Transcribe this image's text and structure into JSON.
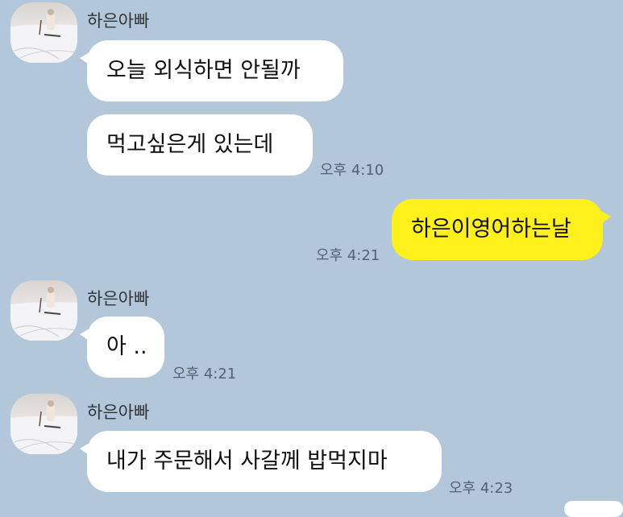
{
  "messages": [
    {
      "sender": "하은아빠",
      "text": "오늘 외식하면 안될까"
    },
    {
      "sender": "하은아빠",
      "text": "먹고싶은게 있는데",
      "time": "오후 4:10"
    },
    {
      "sender": "me",
      "text": "하은이영어하는날",
      "time": "오후 4:21"
    },
    {
      "sender": "하은아빠",
      "text": "아 ..",
      "time": "오후 4:21"
    },
    {
      "sender": "하은아빠",
      "text": "내가 주문해서 사갈께 밥먹지마",
      "time": "오후 4:23"
    }
  ],
  "colors": {
    "background": "#b2c7da",
    "incoming_bubble": "#ffffff",
    "outgoing_bubble": "#fef01b"
  },
  "icons": {
    "avatar": "profile-photo-snow-skier"
  }
}
